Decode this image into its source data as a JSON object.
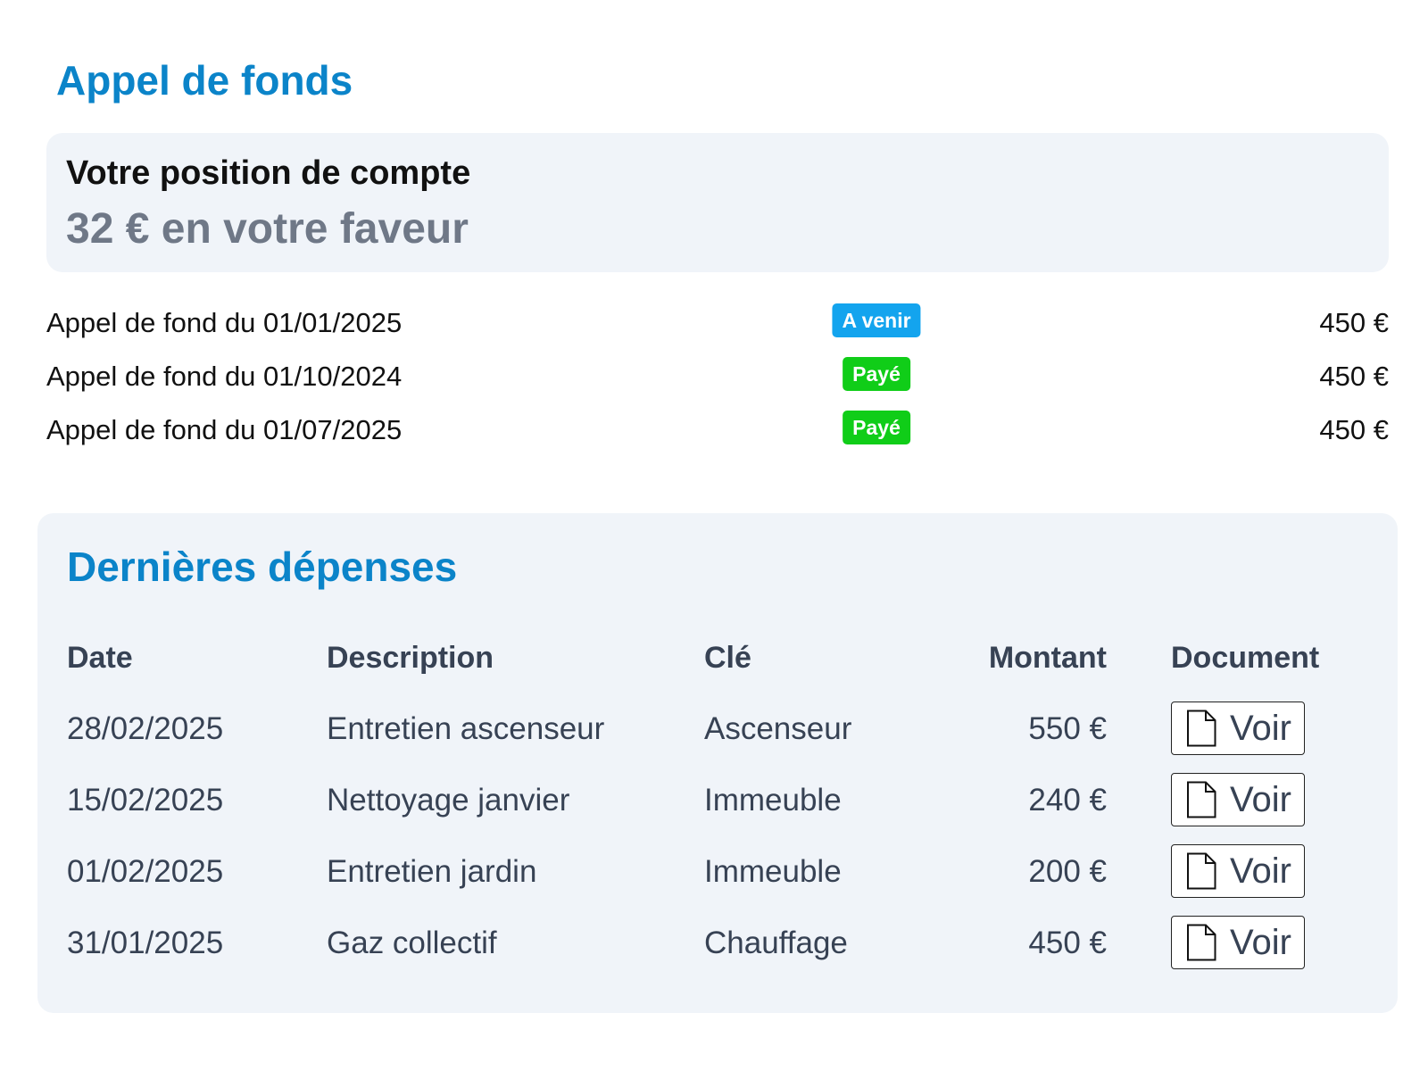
{
  "page": {
    "title": "Appel de fonds"
  },
  "account": {
    "label": "Votre position de compte",
    "value": "32 € en votre faveur"
  },
  "calls": [
    {
      "label": "Appel de fond du 01/01/2025",
      "status": "A venir",
      "status_color": "#13a4ee",
      "amount": "450 €"
    },
    {
      "label": "Appel de fond du 01/10/2024",
      "status": "Payé",
      "status_color": "#10cd18",
      "amount": "450 €"
    },
    {
      "label": "Appel de fond du 01/07/2025",
      "status": "Payé",
      "status_color": "#10cd18",
      "amount": "450 €"
    }
  ],
  "expenses": {
    "title": "Dernières dépenses",
    "columns": {
      "date": "Date",
      "description": "Description",
      "key": "Clé",
      "amount": "Montant",
      "document": "Document"
    },
    "rows": [
      {
        "date": "28/02/2025",
        "description": "Entretien ascenseur",
        "key": "Ascenseur",
        "amount": "550 €",
        "document_label": "Voir",
        "document_icon": "document-icon"
      },
      {
        "date": "15/02/2025",
        "description": "Nettoyage janvier",
        "key": "Immeuble",
        "amount": "240 €",
        "document_label": "Voir",
        "document_icon": "document-icon"
      },
      {
        "date": "01/02/2025",
        "description": "Entretien jardin",
        "key": "Immeuble",
        "amount": "200 €",
        "document_label": "Voir",
        "document_icon": "document-icon"
      },
      {
        "date": "31/01/2025",
        "description": "Gaz collectif",
        "key": "Chauffage",
        "amount": "450 €",
        "document_label": "Voir",
        "document_icon": "document-icon"
      }
    ]
  },
  "colors": {
    "accent": "#0b84c9",
    "card_background": "#f0f4f9",
    "text_dark": "#111111",
    "text_muted": "#6f7887",
    "table_text": "#374254"
  }
}
